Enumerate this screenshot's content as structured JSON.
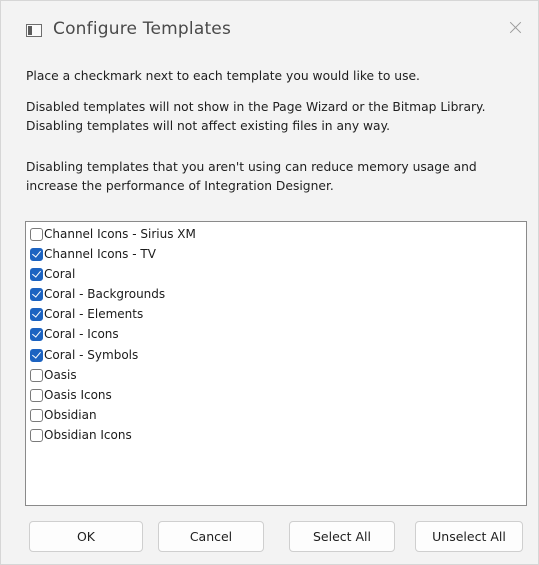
{
  "window": {
    "title": "Configure Templates"
  },
  "instructions": {
    "line1": "Place a checkmark next to each template you would like to use.",
    "line2": "Disabled templates will not show in the Page Wizard or the Bitmap Library. Disabling templates will not affect existing files in any way.",
    "line3": "Disabling templates that you aren't using can reduce memory usage and increase the performance of Integration Designer."
  },
  "templates": [
    {
      "label": "Channel Icons - Sirius XM",
      "checked": false
    },
    {
      "label": "Channel Icons - TV",
      "checked": true
    },
    {
      "label": "Coral",
      "checked": true
    },
    {
      "label": "Coral - Backgrounds",
      "checked": true
    },
    {
      "label": "Coral - Elements",
      "checked": true
    },
    {
      "label": "Coral - Icons",
      "checked": true
    },
    {
      "label": "Coral - Symbols",
      "checked": true
    },
    {
      "label": "Oasis",
      "checked": false
    },
    {
      "label": "Oasis Icons",
      "checked": false
    },
    {
      "label": "Obsidian",
      "checked": false
    },
    {
      "label": "Obsidian Icons",
      "checked": false
    }
  ],
  "buttons": {
    "ok": "OK",
    "cancel": "Cancel",
    "select_all": "Select All",
    "unselect_all": "Unselect All"
  },
  "colors": {
    "checkbox_checked": "#1c63c1",
    "dialog_background": "#f3f3f3"
  }
}
